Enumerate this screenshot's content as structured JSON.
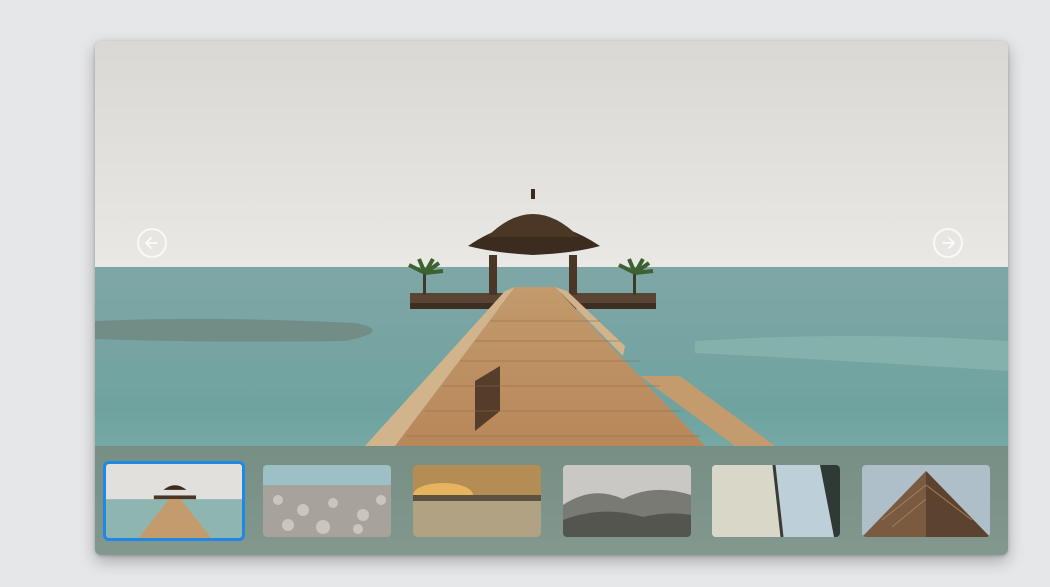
{
  "gallery": {
    "prev_icon": "arrow-left-icon",
    "next_icon": "arrow-right-icon",
    "main_image": "beach-pier-gazebo",
    "selected_index": 0,
    "thumbnails": [
      {
        "subject": "beach-pier-gazebo"
      },
      {
        "subject": "pebble-beach"
      },
      {
        "subject": "sunset-beach"
      },
      {
        "subject": "mountain-hills"
      },
      {
        "subject": "sail-closeup"
      },
      {
        "subject": "wooden-building"
      }
    ],
    "accent_color": "#1e88e5"
  }
}
